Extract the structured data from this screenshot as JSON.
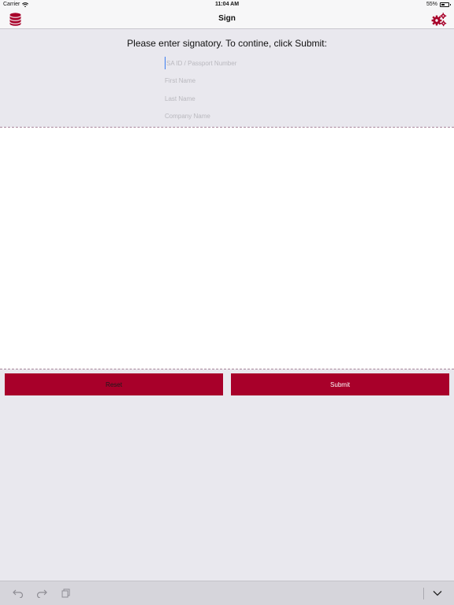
{
  "status_bar": {
    "carrier": "Carrier",
    "time": "11:04 AM",
    "battery_text": "55%",
    "battery_level": 0.55
  },
  "nav": {
    "title": "Sign",
    "left_icon": "database-icon",
    "right_icon": "gears-icon"
  },
  "form": {
    "prompt": "Please enter signatory. To contine, click Submit:",
    "id_placeholder": "SA ID / Passport Number",
    "first_name_placeholder": "First Name",
    "last_name_placeholder": "Last Name",
    "company_placeholder": "Company Name"
  },
  "actions": {
    "reset_label": "Reset",
    "submit_label": "Submit"
  },
  "toolbar": {
    "icons": [
      "undo-icon",
      "redo-icon",
      "paste-icon",
      "chevron-down-icon"
    ]
  },
  "colors": {
    "accent": "#a8002a",
    "background": "#e9e8ee",
    "signature_pad": "#ffffff"
  }
}
